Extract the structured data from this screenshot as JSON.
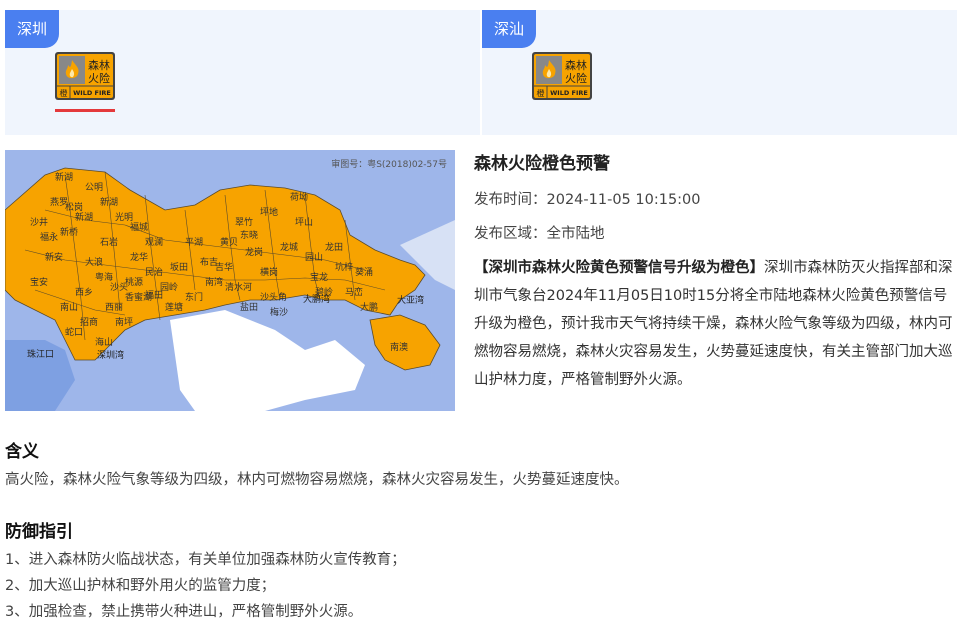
{
  "tabs": [
    {
      "label": "深圳",
      "badge": {
        "level_char": "橙",
        "text1": "森林",
        "text2": "火险",
        "en": "WILD FIRE"
      },
      "selected": true
    },
    {
      "label": "深汕",
      "badge": {
        "level_char": "橙",
        "text1": "森林",
        "text2": "火险",
        "en": "WILD FIRE"
      },
      "selected": false
    }
  ],
  "map": {
    "approval_no": "审图号：粤S(2018)02-57号",
    "labels": [
      "新湖",
      "公明",
      "新湖",
      "新湖",
      "燕罗",
      "沙井",
      "福永",
      "新安",
      "新桥",
      "松岗",
      "石岩",
      "光明",
      "观澜",
      "平湖",
      "龙华",
      "民治",
      "坂田",
      "布吉",
      "南湾",
      "清水河",
      "东门",
      "莲塘",
      "福田",
      "香蜜湖",
      "沙头",
      "粤海",
      "西乡",
      "南山",
      "招商",
      "蛇口",
      "坪地",
      "坪山",
      "龙岗",
      "横岗",
      "龙城",
      "园山",
      "宝龙",
      "龙田",
      "坑梓",
      "碧岭",
      "马峦",
      "葵涌",
      "大鹏",
      "南澳",
      "大鹏湾",
      "大亚湾",
      "珠江口",
      "深圳湾",
      "盐田",
      "梅沙",
      "沙头角",
      "海山",
      "大浪",
      "福城",
      "吉华",
      "南坪",
      "东晓",
      "翠竹",
      "黄贝",
      "宝安",
      "荷坳",
      "西丽",
      "桃源",
      "园岭"
    ]
  },
  "alert": {
    "title": "森林火险橙色预警",
    "time_label": "发布时间：",
    "time": "2024-11-05 10:15:00",
    "area_label": "发布区域：",
    "area": "全市陆地",
    "headline": "【深圳市森林火险黄色预警信号升级为橙色】",
    "body": "深圳市森林防灭火指挥部和深圳市气象台2024年11月05日10时15分将全市陆地森林火险黄色预警信号升级为橙色，预计我市天气将持续干燥，森林火险气象等级为四级，林内可燃物容易燃烧，森林火灾容易发生，火势蔓延速度快，有关主管部门加大巡山护林力度，严格管制野外火源。"
  },
  "meaning": {
    "title": "含义",
    "text": "高火险，森林火险气象等级为四级，林内可燃物容易燃烧，森林火灾容易发生，火势蔓延速度快。"
  },
  "guide": {
    "title": "防御指引",
    "items": [
      "1、进入森林防火临战状态，有关单位加强森林防火宣传教育；",
      "2、加大巡山护林和野外用火的监管力度；",
      "3、加强检查，禁止携带火种进山，严格管制野外火源。"
    ]
  },
  "colors": {
    "accent": "#4a7ff0",
    "orange": "#f7a300",
    "sea": "#9eb6ea",
    "underline": "#e4393c"
  }
}
